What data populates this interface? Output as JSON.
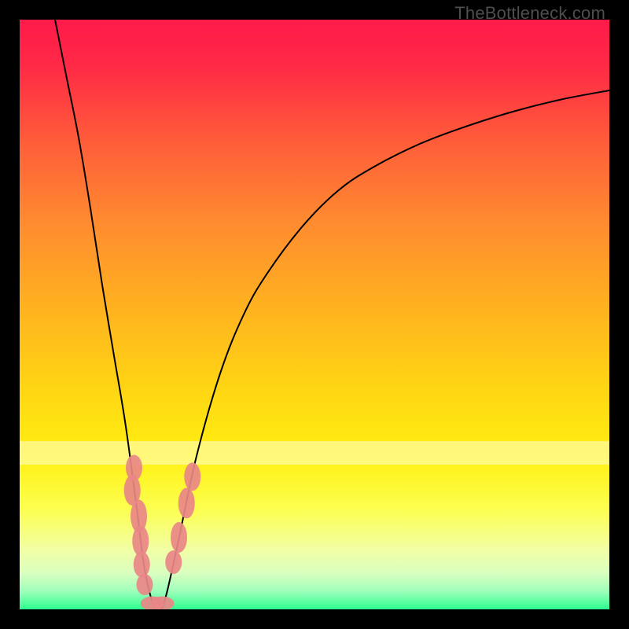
{
  "watermark": "TheBottleneck.com",
  "chart_data": {
    "type": "line",
    "title": "",
    "xlabel": "",
    "ylabel": "",
    "xlim": [
      0,
      100
    ],
    "ylim": [
      0,
      100
    ],
    "grid": false,
    "legend": false,
    "series": [
      {
        "name": "bottleneck-curve",
        "x": [
          6,
          8,
          10,
          12,
          14,
          16,
          18,
          20,
          21,
          22,
          23,
          24,
          25,
          27,
          30,
          34,
          38,
          42,
          48,
          54,
          60,
          68,
          76,
          84,
          92,
          100
        ],
        "y": [
          100,
          90,
          80,
          68,
          55,
          43,
          31,
          16,
          8,
          3,
          0,
          0,
          3,
          12,
          26,
          40,
          50,
          57,
          65,
          71,
          75,
          79,
          82,
          84.5,
          86.5,
          88
        ]
      }
    ],
    "markers": {
      "name": "highlighted-points",
      "color": "#e98787",
      "points": [
        {
          "x": 19.4,
          "y": 24.0,
          "rx": 1.4,
          "ry": 2.2
        },
        {
          "x": 19.1,
          "y": 20.2,
          "rx": 1.4,
          "ry": 2.6
        },
        {
          "x": 20.2,
          "y": 15.8,
          "rx": 1.4,
          "ry": 2.8
        },
        {
          "x": 20.5,
          "y": 11.6,
          "rx": 1.4,
          "ry": 2.6
        },
        {
          "x": 20.7,
          "y": 7.6,
          "rx": 1.4,
          "ry": 2.2
        },
        {
          "x": 21.2,
          "y": 4.2,
          "rx": 1.4,
          "ry": 1.8
        },
        {
          "x": 22.5,
          "y": 1.0,
          "rx": 2.0,
          "ry": 1.2
        },
        {
          "x": 24.2,
          "y": 1.0,
          "rx": 2.0,
          "ry": 1.2
        },
        {
          "x": 26.1,
          "y": 8.0,
          "rx": 1.4,
          "ry": 2.0
        },
        {
          "x": 27.0,
          "y": 12.2,
          "rx": 1.4,
          "ry": 2.6
        },
        {
          "x": 28.3,
          "y": 18.0,
          "rx": 1.4,
          "ry": 2.6
        },
        {
          "x": 29.3,
          "y": 22.5,
          "rx": 1.4,
          "ry": 2.4
        }
      ]
    },
    "background": {
      "type": "vertical-gradient",
      "stops": [
        {
          "pos": 0,
          "color": "#ff1a4a"
        },
        {
          "pos": 8,
          "color": "#ff2a46"
        },
        {
          "pos": 20,
          "color": "#ff5a3a"
        },
        {
          "pos": 34,
          "color": "#ff8a30"
        },
        {
          "pos": 48,
          "color": "#ffb020"
        },
        {
          "pos": 62,
          "color": "#ffd414"
        },
        {
          "pos": 74,
          "color": "#fff010"
        },
        {
          "pos": 83,
          "color": "#fcff50"
        },
        {
          "pos": 90,
          "color": "#f2ffa6"
        },
        {
          "pos": 94,
          "color": "#d8ffc0"
        },
        {
          "pos": 97,
          "color": "#9cffba"
        },
        {
          "pos": 100,
          "color": "#2cff90"
        }
      ]
    }
  }
}
